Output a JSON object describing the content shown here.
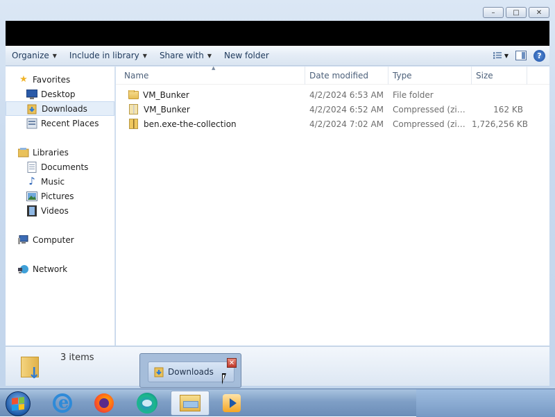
{
  "window": {
    "controls": {
      "minimize": "–",
      "maximize": "□",
      "close": "✕"
    }
  },
  "toolbar": {
    "organize": "Organize",
    "include_in_library": "Include in library",
    "share_with": "Share with",
    "new_folder": "New folder",
    "help": "?"
  },
  "nav": {
    "favorites": "Favorites",
    "desktop": "Desktop",
    "downloads": "Downloads",
    "recent_places": "Recent Places",
    "libraries": "Libraries",
    "documents": "Documents",
    "music": "Music",
    "pictures": "Pictures",
    "videos": "Videos",
    "computer": "Computer",
    "network": "Network"
  },
  "columns": {
    "name": "Name",
    "date_modified": "Date modified",
    "type": "Type",
    "size": "Size"
  },
  "files": [
    {
      "name": "VM_Bunker",
      "date": "4/2/2024 6:53 AM",
      "type": "File folder",
      "size": "",
      "icon": "folder-icon"
    },
    {
      "name": "VM_Bunker",
      "date": "4/2/2024 6:52 AM",
      "type": "Compressed (zipp...",
      "size": "162 KB",
      "icon": "zip-icon"
    },
    {
      "name": "ben.exe-the-collection",
      "date": "4/2/2024 7:02 AM",
      "type": "Compressed (zipp...",
      "size": "1,726,256 KB",
      "icon": "zip-icon"
    }
  ],
  "details": {
    "count": "3 items"
  },
  "thumbnail": {
    "label": "Downloads",
    "close": "✕"
  },
  "taskbar": {
    "apps": [
      "internet-explorer",
      "firefox",
      "edge",
      "windows-explorer",
      "media-player"
    ],
    "active": "windows-explorer"
  }
}
